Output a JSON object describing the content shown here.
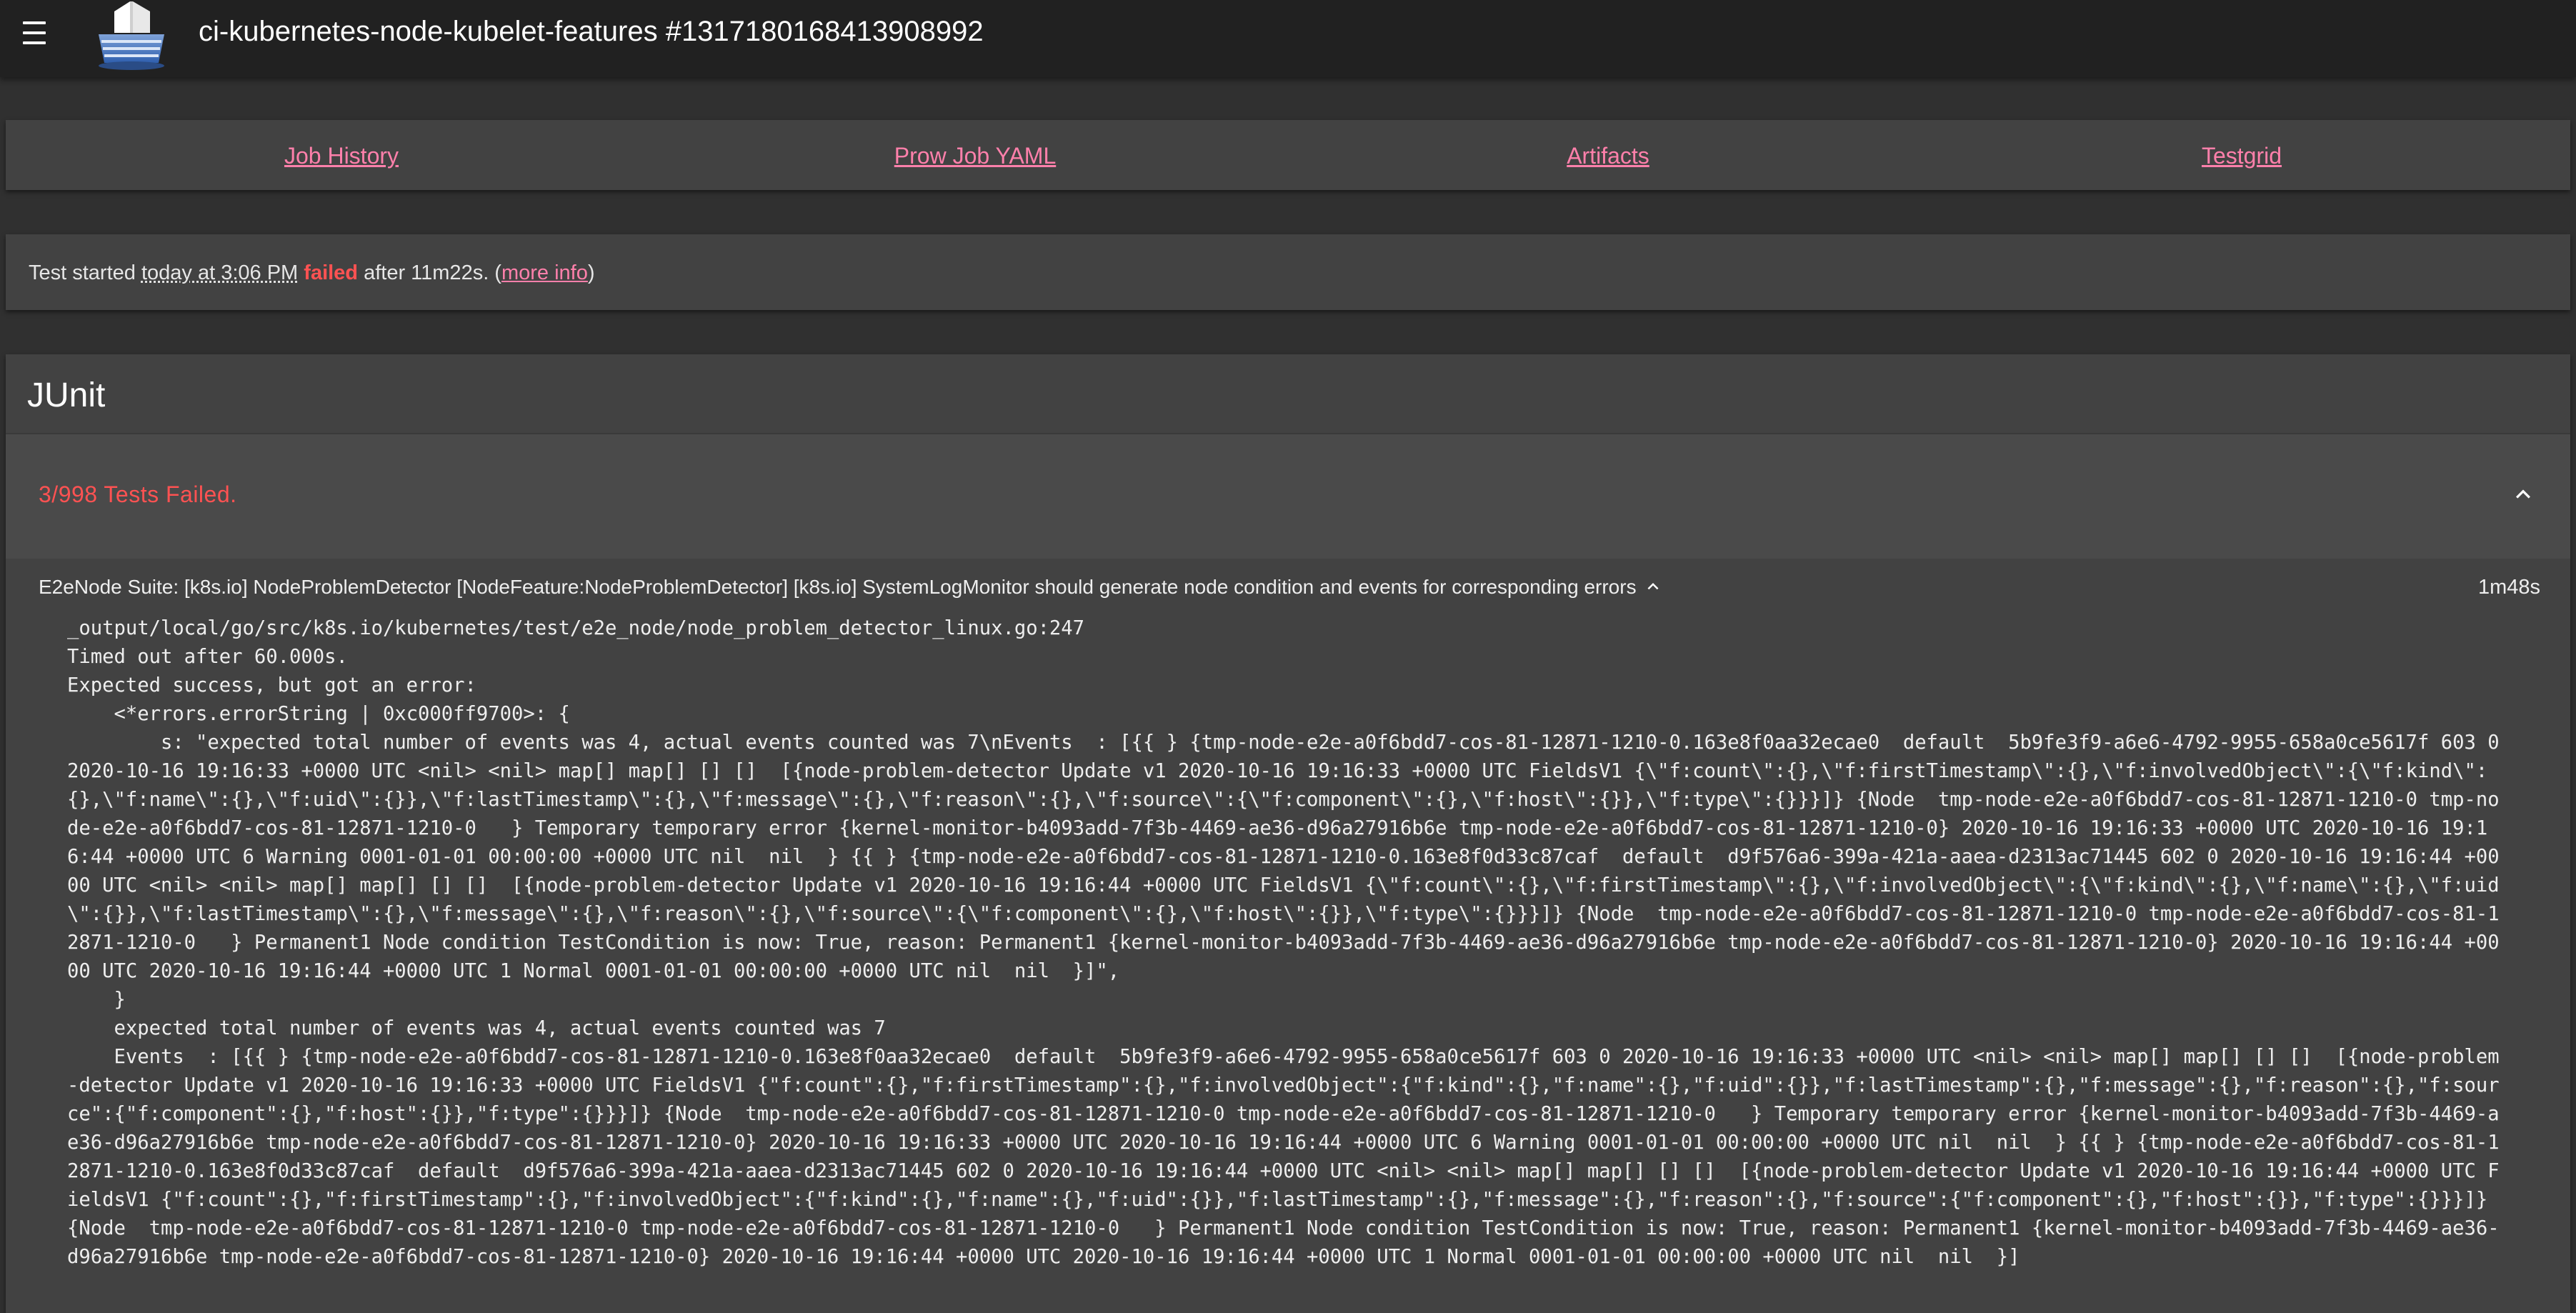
{
  "header": {
    "title": "ci-kubernetes-node-kubelet-features #1317180168413908992",
    "menu_icon": "menu-icon",
    "logo_icon": "prow-ship-logo-icon"
  },
  "links": {
    "job_history": "Job History",
    "prow_job_yaml": "Prow Job YAML",
    "artifacts": "Artifacts",
    "testgrid": "Testgrid"
  },
  "status": {
    "prefix": "Test started ",
    "started": "today at 3:06 PM",
    "space": " ",
    "result": "failed",
    "after": " after 11m22s. (",
    "more_info": "more info",
    "close": ")"
  },
  "junit": {
    "title": "JUnit",
    "summary": "3/998 Tests Failed.",
    "tests": [
      {
        "name": "E2eNode Suite: [k8s.io] NodeProblemDetector [NodeFeature:NodeProblemDetector] [k8s.io] SystemLogMonitor should generate node condition and events for corresponding errors",
        "duration": "1m48s",
        "output": "_output/local/go/src/k8s.io/kubernetes/test/e2e_node/node_problem_detector_linux.go:247\nTimed out after 60.000s.\nExpected success, but got an error:\n    <*errors.errorString | 0xc000ff9700>: {\n        s: \"expected total number of events was 4, actual events counted was 7\\nEvents  : [{{ } {tmp-node-e2e-a0f6bdd7-cos-81-12871-1210-0.163e8f0aa32ecae0  default  5b9fe3f9-a6e6-4792-9955-658a0ce5617f 603 0 2020-10-16 19:16:33 +0000 UTC <nil> <nil> map[] map[] [] []  [{node-problem-detector Update v1 2020-10-16 19:16:33 +0000 UTC FieldsV1 {\\\"f:count\\\":{},\\\"f:firstTimestamp\\\":{},\\\"f:involvedObject\\\":{\\\"f:kind\\\":{},\\\"f:name\\\":{},\\\"f:uid\\\":{}},\\\"f:lastTimestamp\\\":{},\\\"f:message\\\":{},\\\"f:reason\\\":{},\\\"f:source\\\":{\\\"f:component\\\":{},\\\"f:host\\\":{}},\\\"f:type\\\":{}}}]} {Node  tmp-node-e2e-a0f6bdd7-cos-81-12871-1210-0 tmp-node-e2e-a0f6bdd7-cos-81-12871-1210-0   } Temporary temporary error {kernel-monitor-b4093add-7f3b-4469-ae36-d96a27916b6e tmp-node-e2e-a0f6bdd7-cos-81-12871-1210-0} 2020-10-16 19:16:33 +0000 UTC 2020-10-16 19:16:44 +0000 UTC 6 Warning 0001-01-01 00:00:00 +0000 UTC nil  nil  } {{ } {tmp-node-e2e-a0f6bdd7-cos-81-12871-1210-0.163e8f0d33c87caf  default  d9f576a6-399a-421a-aaea-d2313ac71445 602 0 2020-10-16 19:16:44 +0000 UTC <nil> <nil> map[] map[] [] []  [{node-problem-detector Update v1 2020-10-16 19:16:44 +0000 UTC FieldsV1 {\\\"f:count\\\":{},\\\"f:firstTimestamp\\\":{},\\\"f:involvedObject\\\":{\\\"f:kind\\\":{},\\\"f:name\\\":{},\\\"f:uid\\\":{}},\\\"f:lastTimestamp\\\":{},\\\"f:message\\\":{},\\\"f:reason\\\":{},\\\"f:source\\\":{\\\"f:component\\\":{},\\\"f:host\\\":{}},\\\"f:type\\\":{}}}]} {Node  tmp-node-e2e-a0f6bdd7-cos-81-12871-1210-0 tmp-node-e2e-a0f6bdd7-cos-81-12871-1210-0   } Permanent1 Node condition TestCondition is now: True, reason: Permanent1 {kernel-monitor-b4093add-7f3b-4469-ae36-d96a27916b6e tmp-node-e2e-a0f6bdd7-cos-81-12871-1210-0} 2020-10-16 19:16:44 +0000 UTC 2020-10-16 19:16:44 +0000 UTC 1 Normal 0001-01-01 00:00:00 +0000 UTC nil  nil  }]\",\n    }\n    expected total number of events was 4, actual events counted was 7\n    Events  : [{{ } {tmp-node-e2e-a0f6bdd7-cos-81-12871-1210-0.163e8f0aa32ecae0  default  5b9fe3f9-a6e6-4792-9955-658a0ce5617f 603 0 2020-10-16 19:16:33 +0000 UTC <nil> <nil> map[] map[] [] []  [{node-problem-detector Update v1 2020-10-16 19:16:33 +0000 UTC FieldsV1 {\"f:count\":{},\"f:firstTimestamp\":{},\"f:involvedObject\":{\"f:kind\":{},\"f:name\":{},\"f:uid\":{}},\"f:lastTimestamp\":{},\"f:message\":{},\"f:reason\":{},\"f:source\":{\"f:component\":{},\"f:host\":{}},\"f:type\":{}}}]} {Node  tmp-node-e2e-a0f6bdd7-cos-81-12871-1210-0 tmp-node-e2e-a0f6bdd7-cos-81-12871-1210-0   } Temporary temporary error {kernel-monitor-b4093add-7f3b-4469-ae36-d96a27916b6e tmp-node-e2e-a0f6bdd7-cos-81-12871-1210-0} 2020-10-16 19:16:33 +0000 UTC 2020-10-16 19:16:44 +0000 UTC 6 Warning 0001-01-01 00:00:00 +0000 UTC nil  nil  } {{ } {tmp-node-e2e-a0f6bdd7-cos-81-12871-1210-0.163e8f0d33c87caf  default  d9f576a6-399a-421a-aaea-d2313ac71445 602 0 2020-10-16 19:16:44 +0000 UTC <nil> <nil> map[] map[] [] []  [{node-problem-detector Update v1 2020-10-16 19:16:44 +0000 UTC FieldsV1 {\"f:count\":{},\"f:firstTimestamp\":{},\"f:involvedObject\":{\"f:kind\":{},\"f:name\":{},\"f:uid\":{}},\"f:lastTimestamp\":{},\"f:message\":{},\"f:reason\":{},\"f:source\":{\"f:component\":{},\"f:host\":{}},\"f:type\":{}}}]} {Node  tmp-node-e2e-a0f6bdd7-cos-81-12871-1210-0 tmp-node-e2e-a0f6bdd7-cos-81-12871-1210-0   } Permanent1 Node condition TestCondition is now: True, reason: Permanent1 {kernel-monitor-b4093add-7f3b-4469-ae36-d96a27916b6e tmp-node-e2e-a0f6bdd7-cos-81-12871-1210-0} 2020-10-16 19:16:44 +0000 UTC 2020-10-16 19:16:44 +0000 UTC 1 Normal 0001-01-01 00:00:00 +0000 UTC nil  nil  }]"
      }
    ]
  },
  "icons": {
    "summary_toggle": "chevron-up-icon",
    "test_toggle": "chevron-up-icon"
  },
  "colors": {
    "accent_link": "#ff80ab",
    "failed": "#ff5252",
    "appbar": "#212121",
    "card": "#424242",
    "background": "#303030"
  }
}
